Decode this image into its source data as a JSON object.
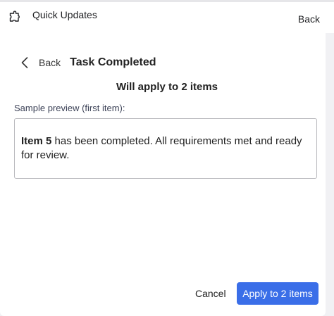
{
  "app": {
    "title": "Quick Updates",
    "back_label": "Back"
  },
  "dialog": {
    "back_label": "Back",
    "title": "Task Completed",
    "apply_heading": "Will apply to 2 items",
    "preview_label": "Sample preview (first item):",
    "preview": {
      "item_name": "Item 5",
      "message": " has been completed. All requirements met and ready for review."
    },
    "cancel_label": "Cancel",
    "apply_label": "Apply to 2 items"
  },
  "colors": {
    "accent": "#3a6ee8",
    "background": "#f1f1f4"
  },
  "icons": {
    "app_icon": "puzzle-piece-icon",
    "back_icon": "chevron-left-icon"
  }
}
